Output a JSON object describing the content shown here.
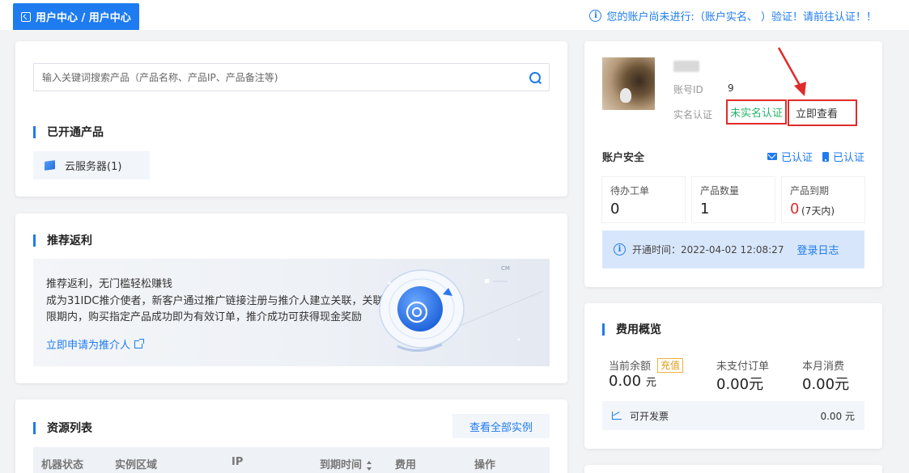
{
  "header": {
    "breadcrumb": "用户中心 / 用户中心",
    "notice": "您的账户尚未进行:（账户实名、 ）验证！请前往认证！！"
  },
  "search": {
    "placeholder": "输入关键词搜索产品（产品名称、产品IP、产品备注等)",
    "value": ""
  },
  "products": {
    "title": "已开通产品",
    "items": [
      {
        "label": "云服务器(1)",
        "icon": "cube-icon"
      }
    ]
  },
  "referral": {
    "title": "推荐返利",
    "headline": "推荐返利，无门槛轻松赚钱",
    "description": "成为31IDC推介使者，新客户通过推广链接注册与推介人建立关联，关联有限期内，购买指定产品成功即为有效订单，推介成功可获得现金奖励",
    "link": "立即申请为推介人",
    "art_text": "CM"
  },
  "resources": {
    "title": "资源列表",
    "view_all": "查看全部实例",
    "columns": [
      "机器状态",
      "实例区域",
      "IP",
      "到期时间",
      "费用",
      "操作"
    ]
  },
  "account": {
    "id_label": "账号ID",
    "id_value": "9",
    "realname_label": "实名认证",
    "realname_status": "未实名认证",
    "verify_button": "立即查看",
    "security_label": "账户安全",
    "email_status": "已认证",
    "phone_status": "已认证",
    "stats": [
      {
        "label": "待办工单",
        "value": "0"
      },
      {
        "label": "产品数量",
        "value": "1"
      },
      {
        "label": "产品到期",
        "value": "0",
        "note": "(7天内)"
      }
    ],
    "open_time_label": "开通时间：2022-04-02 12:08:27",
    "login_log": "登录日志"
  },
  "fees": {
    "title": "费用概览",
    "balance_label": "当前余额",
    "balance_value": "0.00",
    "balance_unit": "元",
    "recharge": "充值",
    "unpaid_label": "未支付订单",
    "unpaid_value": "0.00元",
    "monthly_label": "本月消费",
    "monthly_value": "0.00元",
    "invoice_label": "可开发票",
    "invoice_value": "0.00 元"
  },
  "colors": {
    "accent": "#1e7bf0",
    "danger": "#e02b2b",
    "success": "#27b36a",
    "warning": "#f0b23d"
  }
}
